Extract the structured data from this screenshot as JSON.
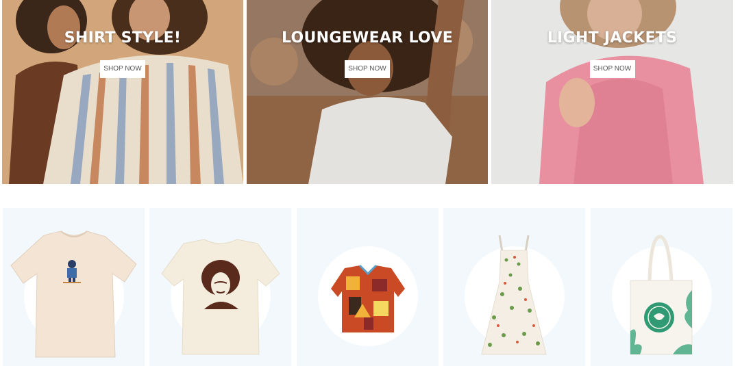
{
  "banners": [
    {
      "title": "SHIRT STYLE!",
      "button_label": "SHOP NOW"
    },
    {
      "title": "LOUNGEWEAR LOVE",
      "button_label": "SHOP NOW"
    },
    {
      "title": "LIGHT JACKETS",
      "button_label": "SHOP NOW"
    }
  ],
  "products": [
    {
      "name": "cream-graphic-tshirt"
    },
    {
      "name": "portrait-print-tshirt"
    },
    {
      "name": "patterned-camp-shirt"
    },
    {
      "name": "floral-sundress"
    },
    {
      "name": "canvas-tote-bag"
    }
  ],
  "colors": {
    "tile_background": "#f2f8fb",
    "button_background": "#ffffff",
    "button_text": "#555555",
    "banner_text": "#ffffff"
  }
}
